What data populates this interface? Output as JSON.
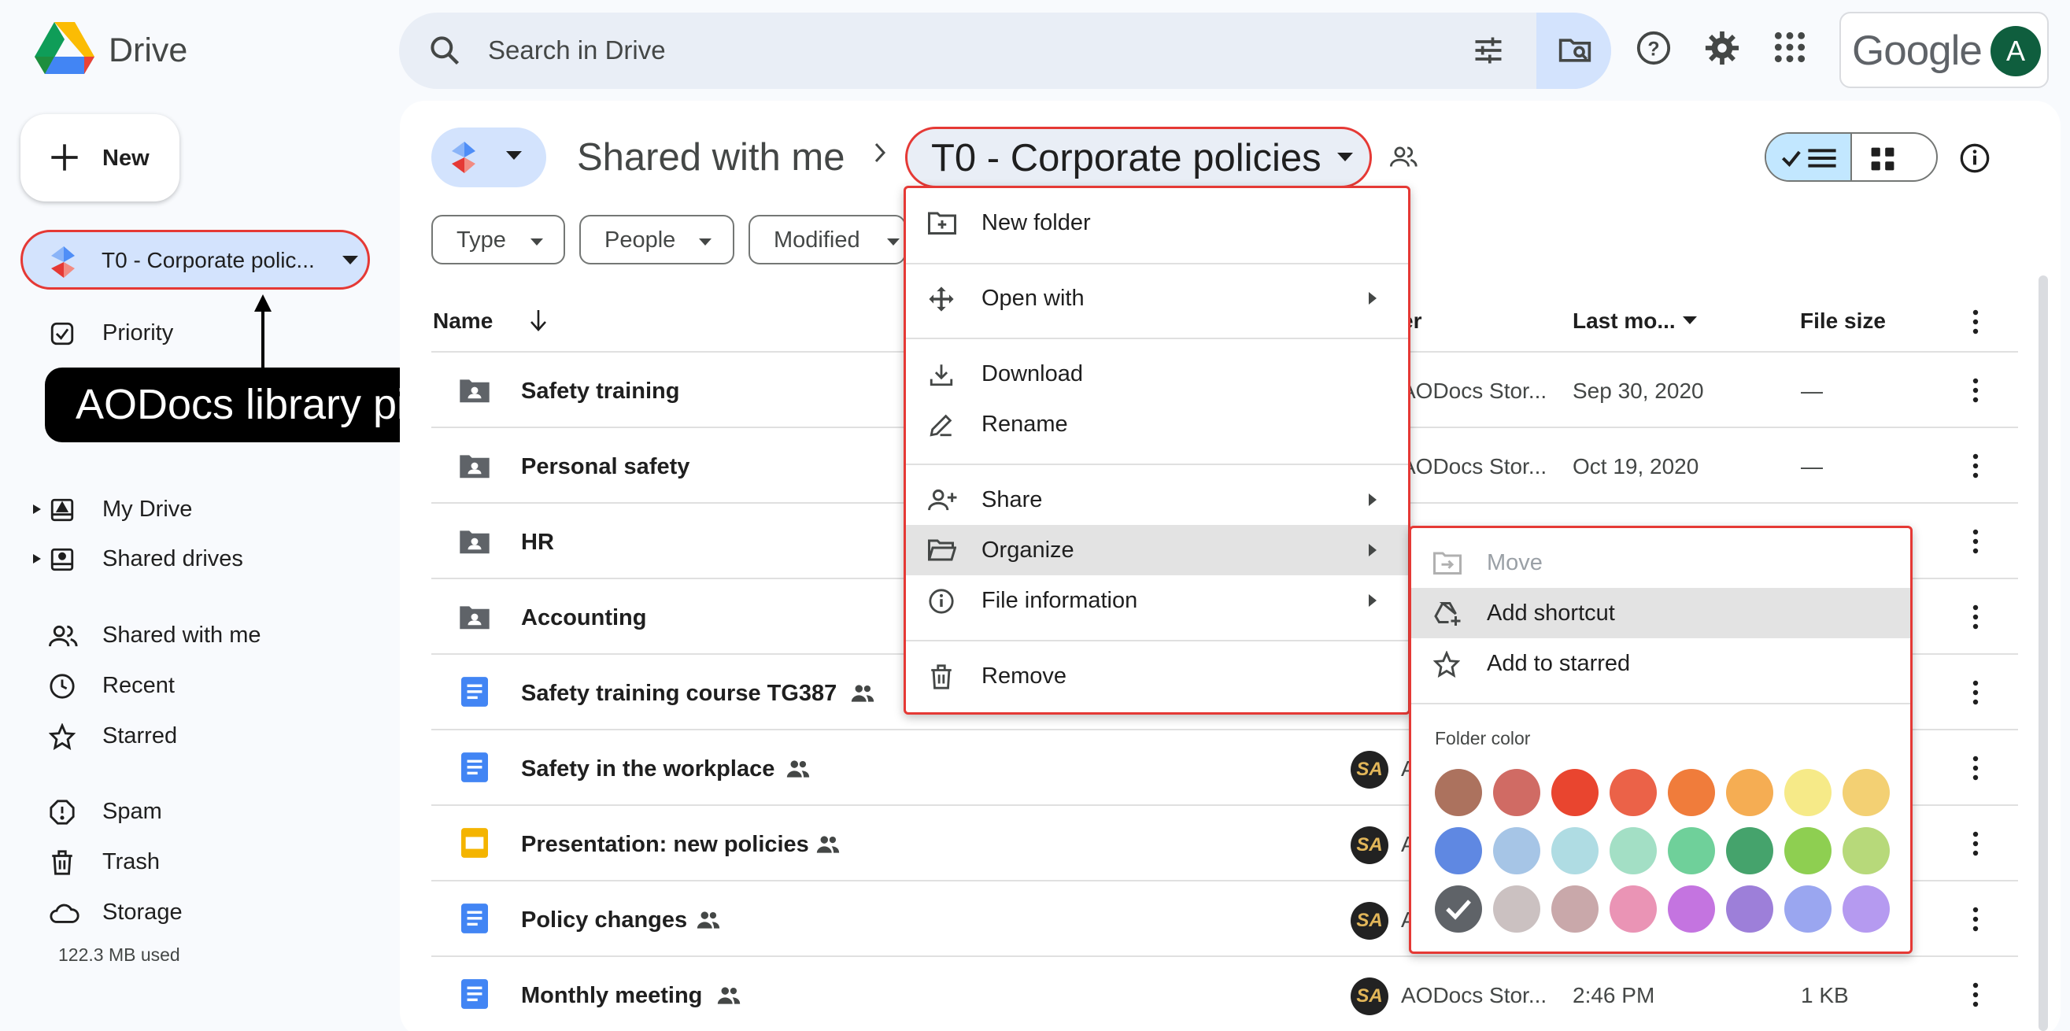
{
  "header": {
    "app_name": "Drive",
    "search_placeholder": "Search in Drive",
    "brand_word": "Google",
    "avatar_letter": "A"
  },
  "sidebar": {
    "new_label": "New",
    "library_picker_label": "T0 - Corporate polic...",
    "items": [
      {
        "label": "Priority",
        "icon": "priority-icon"
      },
      {
        "label": "My Drive",
        "icon": "my-drive-icon"
      },
      {
        "label": "Shared drives",
        "icon": "shared-drives-icon"
      },
      {
        "label": "Shared with me",
        "icon": "people-icon"
      },
      {
        "label": "Recent",
        "icon": "clock-icon"
      },
      {
        "label": "Starred",
        "icon": "star-icon"
      },
      {
        "label": "Spam",
        "icon": "spam-icon"
      },
      {
        "label": "Trash",
        "icon": "trash-icon"
      },
      {
        "label": "Storage",
        "icon": "cloud-icon"
      }
    ],
    "storage_used": "122.3 MB used"
  },
  "callout": {
    "text": "AODocs library picker"
  },
  "breadcrumb": {
    "parent": "Shared with me",
    "current": "T0 - Corporate policies"
  },
  "filters": [
    "Type",
    "People",
    "Modified"
  ],
  "table": {
    "columns": {
      "name": "Name",
      "owner": "er",
      "modified": "Last mo...",
      "size": "File size"
    },
    "rows": [
      {
        "name": "Safety training",
        "type": "shared-folder",
        "owner": "AODocs Stor...",
        "modified": "Sep 30, 2020",
        "size": "—"
      },
      {
        "name": "Personal safety",
        "type": "shared-folder",
        "owner": "AODocs Stor...",
        "modified": "Oct 19, 2020",
        "size": "—"
      },
      {
        "name": "HR",
        "type": "shared-folder",
        "owner": "",
        "modified": "",
        "size": ""
      },
      {
        "name": "Accounting",
        "type": "shared-folder",
        "owner": "",
        "modified": "",
        "size": ""
      },
      {
        "name": "Safety training course TG387",
        "type": "doc",
        "owner": "",
        "modified": "",
        "size": ""
      },
      {
        "name": "Safety in the workplace",
        "type": "doc",
        "owner": "A",
        "modified": "",
        "size": ""
      },
      {
        "name": "Presentation: new policies",
        "type": "slides",
        "owner": "A",
        "modified": "",
        "size": ""
      },
      {
        "name": "Policy changes",
        "type": "doc",
        "owner": "A",
        "modified": "",
        "size": ""
      },
      {
        "name": "Monthly meeting",
        "type": "doc",
        "owner": "AODocs Stor...",
        "modified": "2:46 PM",
        "size": "1 KB"
      }
    ],
    "owner_avatar_text": "SA"
  },
  "context_menu": {
    "items": [
      {
        "label": "New folder",
        "icon": "new-folder-icon"
      },
      {
        "label": "Open with",
        "icon": "open-with-icon"
      },
      {
        "label": "Download",
        "icon": "download-icon"
      },
      {
        "label": "Rename",
        "icon": "rename-icon"
      },
      {
        "label": "Share",
        "icon": "share-icon"
      },
      {
        "label": "Organize",
        "icon": "organize-icon"
      },
      {
        "label": "File information",
        "icon": "info-icon"
      },
      {
        "label": "Remove",
        "icon": "trash-icon"
      }
    ]
  },
  "submenu": {
    "items": [
      {
        "label": "Move",
        "disabled": true
      },
      {
        "label": "Add shortcut"
      },
      {
        "label": "Add to starred"
      }
    ],
    "folder_color_label": "Folder color",
    "colors": [
      "#ac725e",
      "#d06b64",
      "#e9452f",
      "#eb6248",
      "#f07c3b",
      "#f5ad53",
      "#f6ea88",
      "#f3d073",
      "#5f88e2",
      "#a6c5e6",
      "#afdce3",
      "#a3dfc5",
      "#6fd09a",
      "#45a36c",
      "#8ecf51",
      "#b7d97a",
      "#5f6368",
      "#cbc1c1",
      "#c9a8aa",
      "#ea94b5",
      "#c474e0",
      "#9d7fd9",
      "#9aa6f0",
      "#b59af0"
    ],
    "selected_color": "#5f6368"
  }
}
